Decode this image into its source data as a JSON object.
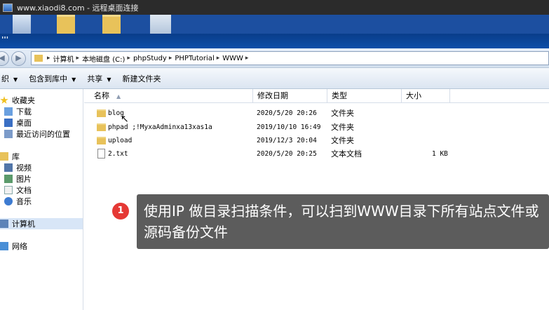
{
  "remote_title": "www.xiaodi8.com - 远程桌面连接",
  "explorer_title": "'''",
  "address": {
    "breadcrumbs": [
      "计算机",
      "本地磁盘 (C:)",
      "phpStudy",
      "PHPTutorial",
      "WWW"
    ]
  },
  "toolbar": {
    "organize": "织",
    "include_in_library": "包含到库中",
    "share": "共享",
    "new_folder": "新建文件夹"
  },
  "nav": {
    "favorites": "收藏夹",
    "downloads": "下载",
    "desktop": "桌面",
    "recent": "最近访问的位置",
    "libraries": "库",
    "videos": "视频",
    "pictures": "图片",
    "documents": "文档",
    "music": "音乐",
    "computer": "计算机",
    "network": "网络"
  },
  "columns": {
    "name": "名称",
    "modified": "修改日期",
    "type": "类型",
    "size": "大小"
  },
  "files": [
    {
      "name": "blog",
      "modified": "2020/5/20 20:26",
      "type": "文件夹",
      "size": "",
      "icon": "folder-icon"
    },
    {
      "name": "phpad ;!MyxaAdminxa13xas1a",
      "modified": "2019/10/10 16:49",
      "type": "文件夹",
      "size": "",
      "icon": "folder-icon"
    },
    {
      "name": "upload",
      "modified": "2019/12/3 20:04",
      "type": "文件夹",
      "size": "",
      "icon": "folder-icon"
    },
    {
      "name": "2.txt",
      "modified": "2020/5/20 20:25",
      "type": "文本文档",
      "size": "1 KB",
      "icon": "text-file-icon"
    }
  ],
  "caption": {
    "number": "1",
    "text": "使用IP 做目录扫描条件，可以扫到WWW目录下所有站点文件或源码备份文件"
  }
}
